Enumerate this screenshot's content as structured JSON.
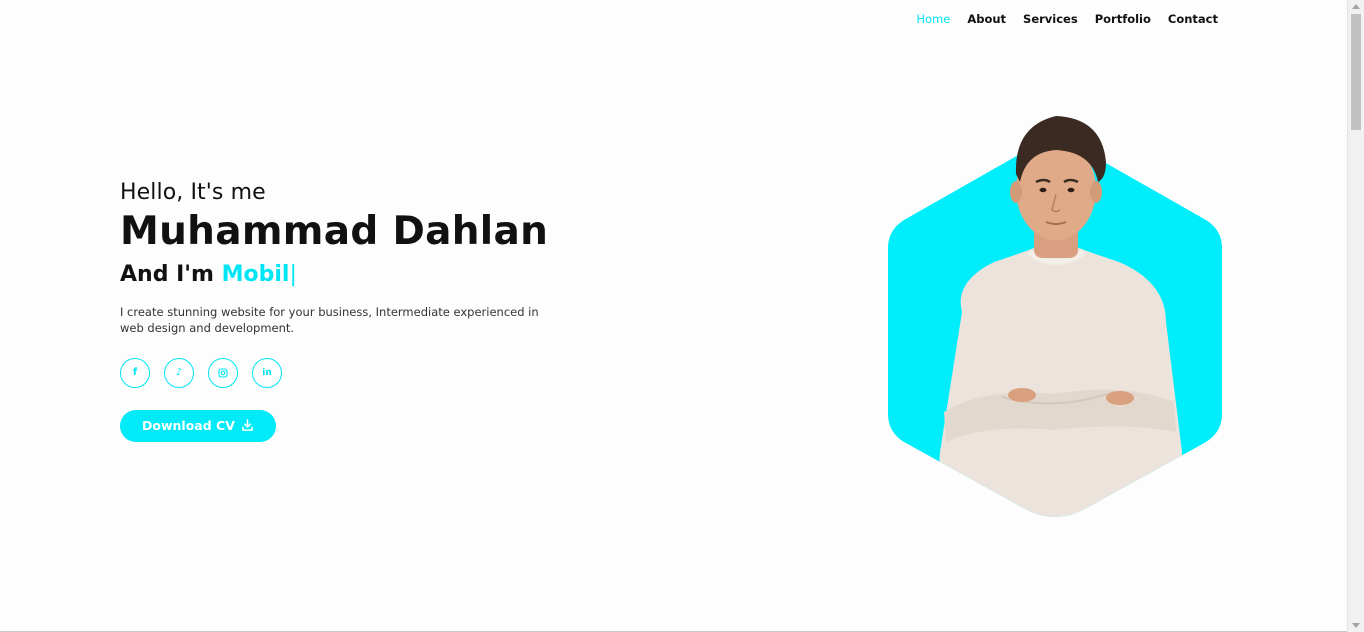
{
  "nav": {
    "items": [
      {
        "label": "Home",
        "active": true
      },
      {
        "label": "About",
        "active": false
      },
      {
        "label": "Services",
        "active": false
      },
      {
        "label": "Portfolio",
        "active": false
      },
      {
        "label": "Contact",
        "active": false
      }
    ]
  },
  "hero": {
    "greeting": "Hello, It's me",
    "name": "Muhammad Dahlan",
    "role_prefix": "And I'm ",
    "role_typed": "Mobil",
    "caret": "|",
    "description": "I create stunning website for your business, Intermediate experienced in web design and development.",
    "socials": [
      {
        "icon": "facebook-icon",
        "glyph": "f"
      },
      {
        "icon": "tiktok-icon",
        "glyph": "♪"
      },
      {
        "icon": "instagram-icon",
        "glyph": ""
      },
      {
        "icon": "linkedin-icon",
        "glyph": "in"
      }
    ],
    "cta_label": "Download CV"
  },
  "colors": {
    "accent": "#00e5f5",
    "text": "#111111"
  }
}
